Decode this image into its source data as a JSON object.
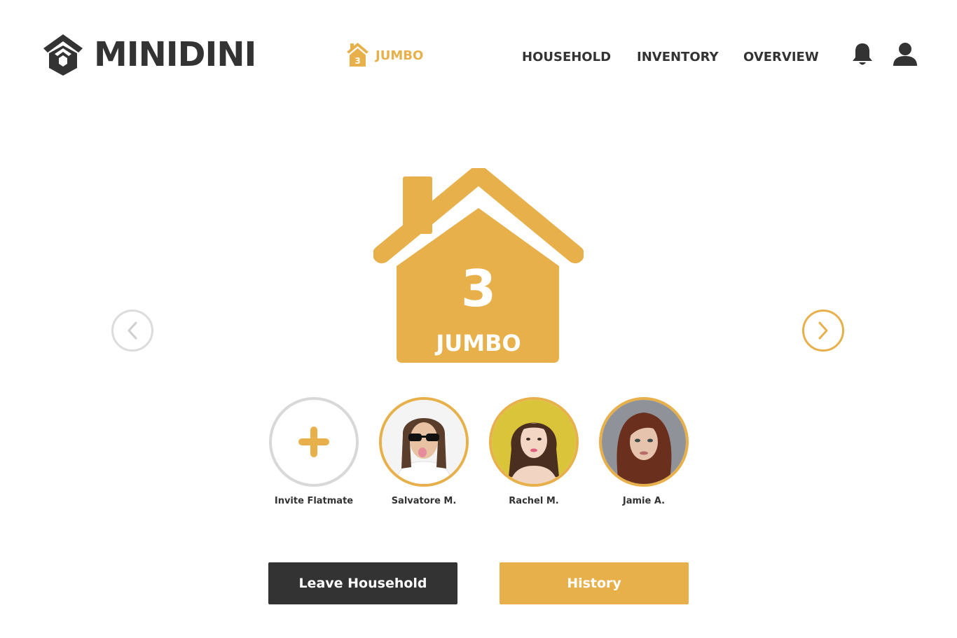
{
  "brand": {
    "name": "MINIDINI",
    "logo_icon": "hexagon-house-icon"
  },
  "header": {
    "current_household": {
      "number": "3",
      "name": "JUMBO",
      "icon": "house-icon"
    },
    "nav": [
      {
        "label": "HOUSEHOLD"
      },
      {
        "label": "INVENTORY"
      },
      {
        "label": "OVERVIEW"
      }
    ],
    "icons": [
      "bell-icon",
      "user-icon"
    ]
  },
  "household": {
    "number": "3",
    "name": "JUMBO",
    "icon": "house-icon"
  },
  "carousel": {
    "prev_icon": "chevron-left-icon",
    "next_icon": "chevron-right-icon"
  },
  "members": [
    {
      "name": "Invite Flatmate",
      "type": "invite",
      "icon": "plus-icon"
    },
    {
      "name": "Salvatore M.",
      "type": "photo"
    },
    {
      "name": "Rachel M.",
      "type": "photo"
    },
    {
      "name": "Jamie A.",
      "type": "photo"
    }
  ],
  "actions": {
    "leave_label": "Leave Household",
    "history_label": "History"
  },
  "colors": {
    "accent": "#e8b04a",
    "dark": "#333333",
    "muted_border": "#d8d8d8"
  }
}
